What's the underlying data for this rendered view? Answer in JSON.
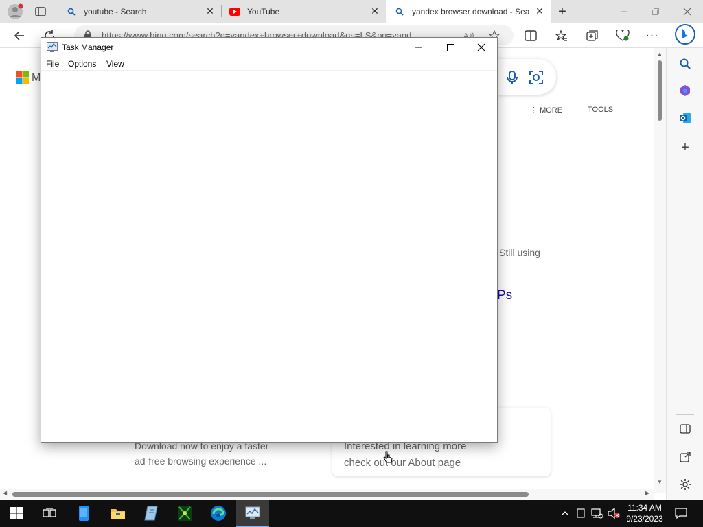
{
  "browser": {
    "tabs": [
      {
        "title": "youtube - Search",
        "icon": "search-icon"
      },
      {
        "title": "YouTube",
        "icon": "youtube-icon"
      },
      {
        "title": "yandex browser download - Sea",
        "icon": "search-icon",
        "active": true
      }
    ],
    "address_url": "https://www.bing.com/search?q=yandex+browser+download&qs=LS&pq=yand"
  },
  "page": {
    "nav": {
      "more_label": "MORE",
      "tools_label": "TOOLS"
    },
    "snippet_still_using": "Still using",
    "snippet_ps": "Ps",
    "result_left": {
      "line1": "Download now to enjoy a faster",
      "line2": "ad-free browsing experience ..."
    },
    "result_right": {
      "line1": "Interested in learning more",
      "line2": "check out our About page"
    },
    "logo_letter": "M"
  },
  "task_manager": {
    "title": "Task Manager",
    "menu": [
      "File",
      "Options",
      "View"
    ]
  },
  "taskbar": {
    "clock_time": "11:34 AM",
    "clock_date": "9/23/2023"
  },
  "colors": {
    "accent": "#0f6cbd",
    "youtube_red": "#ff0000",
    "taskbar_bg": "#101010"
  }
}
